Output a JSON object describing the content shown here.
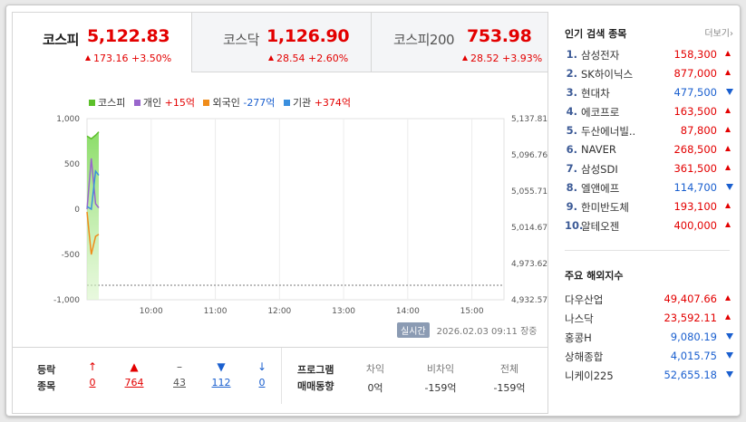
{
  "tabs": [
    {
      "name": "코스피",
      "value": "5,122.83",
      "change": "173.16 +3.50%",
      "active": true
    },
    {
      "name": "코스닥",
      "value": "1,126.90",
      "change": "28.54 +2.60%",
      "active": false
    },
    {
      "name": "코스피200",
      "value": "753.98",
      "change": "28.52 +3.93%",
      "active": false
    }
  ],
  "legend": {
    "kospi": {
      "label": "코스피",
      "color": "#5cc02a"
    },
    "individual": {
      "label": "개인",
      "value": "+15억",
      "color": "#9966cc"
    },
    "foreign": {
      "label": "외국인",
      "value": "-277억",
      "color": "#f08c1a"
    },
    "institution": {
      "label": "기관",
      "value": "+374억",
      "color": "#3a8fde"
    }
  },
  "chart_data": {
    "type": "line",
    "left_axis": {
      "ticks": [
        "1,000",
        "500",
        "0",
        "-500",
        "-1,000"
      ],
      "values": [
        1000,
        500,
        0,
        -500,
        -1000
      ],
      "ylim": [
        -1000,
        1000
      ]
    },
    "right_axis": {
      "ticks": [
        "5,137.81",
        "5,096.76",
        "5,055.71",
        "5,014.67",
        "4,973.62",
        "4,932.57"
      ],
      "values": [
        5137.81,
        5096.76,
        5055.71,
        5014.67,
        4973.62,
        4932.57
      ],
      "ylim": [
        4932.57,
        5137.81
      ]
    },
    "x_ticks": [
      "10:00",
      "11:00",
      "12:00",
      "13:00",
      "14:00",
      "15:00"
    ],
    "x_range_minutes": [
      540,
      930
    ],
    "reference_line": 4949,
    "series": [
      {
        "name": "코스피",
        "axis": "right",
        "color": "#5cc02a",
        "fill": true,
        "x": [
          "09:00",
          "09:04",
          "09:08",
          "09:11"
        ],
        "y": [
          5118,
          5115,
          5119,
          5122.83
        ]
      },
      {
        "name": "개인",
        "axis": "left",
        "color": "#9966cc",
        "x": [
          "09:00",
          "09:04",
          "09:08",
          "09:11"
        ],
        "y": [
          0,
          560,
          60,
          15
        ]
      },
      {
        "name": "외국인",
        "axis": "left",
        "color": "#f08c1a",
        "x": [
          "09:00",
          "09:04",
          "09:08",
          "09:11"
        ],
        "y": [
          -30,
          -500,
          -300,
          -277
        ]
      },
      {
        "name": "기관",
        "axis": "left",
        "color": "#3a8fde",
        "x": [
          "09:00",
          "09:04",
          "09:08",
          "09:11"
        ],
        "y": [
          30,
          0,
          420,
          374
        ]
      }
    ]
  },
  "timestamp": {
    "badge": "실시간",
    "datetime": "2026.02.03 09:11",
    "status": "장중"
  },
  "breadth": {
    "label_line1": "등락",
    "label_line2": "종목",
    "items": [
      {
        "key": "limit_up",
        "icon": "↑",
        "count": "0"
      },
      {
        "key": "up",
        "icon": "▲",
        "count": "764"
      },
      {
        "key": "flat",
        "icon": "–",
        "count": "43"
      },
      {
        "key": "down",
        "icon": "▼",
        "count": "112"
      },
      {
        "key": "limit_down",
        "icon": "↓",
        "count": "0"
      }
    ]
  },
  "program": {
    "label_line1": "프로그램",
    "label_line2": "매매동향",
    "columns": [
      {
        "header": "차익",
        "value": "0억"
      },
      {
        "header": "비차익",
        "value": "-159억"
      },
      {
        "header": "전체",
        "value": "-159억"
      }
    ]
  },
  "popular": {
    "title": "인기 검색 종목",
    "more": "더보기",
    "items": [
      {
        "rank": "1.",
        "name": "삼성전자",
        "price": "158,300",
        "dir": "up"
      },
      {
        "rank": "2.",
        "name": "SK하이닉스",
        "price": "877,000",
        "dir": "up"
      },
      {
        "rank": "3.",
        "name": "현대차",
        "price": "477,500",
        "dir": "down"
      },
      {
        "rank": "4.",
        "name": "에코프로",
        "price": "163,500",
        "dir": "up"
      },
      {
        "rank": "5.",
        "name": "두산에너빌..",
        "price": "87,800",
        "dir": "up"
      },
      {
        "rank": "6.",
        "name": "NAVER",
        "price": "268,500",
        "dir": "up"
      },
      {
        "rank": "7.",
        "name": "삼성SDI",
        "price": "361,500",
        "dir": "up"
      },
      {
        "rank": "8.",
        "name": "엘앤에프",
        "price": "114,700",
        "dir": "down"
      },
      {
        "rank": "9.",
        "name": "한미반도체",
        "price": "193,100",
        "dir": "up"
      },
      {
        "rank": "10.",
        "name": "알테오젠",
        "price": "400,000",
        "dir": "up"
      }
    ]
  },
  "overseas": {
    "title": "주요 해외지수",
    "items": [
      {
        "name": "다우산업",
        "value": "49,407.66",
        "dir": "up"
      },
      {
        "name": "나스닥",
        "value": "23,592.11",
        "dir": "up"
      },
      {
        "name": "홍콩H",
        "value": "9,080.19",
        "dir": "down"
      },
      {
        "name": "상해종합",
        "value": "4,015.75",
        "dir": "down"
      },
      {
        "name": "니케이225",
        "value": "52,655.18",
        "dir": "down"
      }
    ]
  },
  "colors": {
    "up": "#e30000",
    "down": "#1a5fcf",
    "rank": "#3c5a96"
  }
}
